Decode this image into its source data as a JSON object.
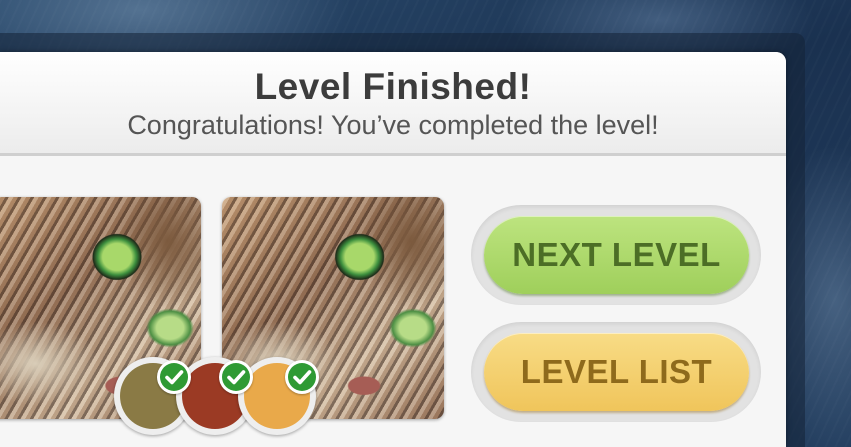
{
  "dialog": {
    "title": "Level Finished!",
    "subtitle": "Congratulations! You’ve completed the level!"
  },
  "buttons": {
    "next_level": "NEXT LEVEL",
    "level_list": "LEVEL LIST"
  },
  "color_swatches": [
    {
      "color": "#8a7a45",
      "completed": true
    },
    {
      "color": "#9b3a24",
      "completed": true
    },
    {
      "color": "#e9a94a",
      "completed": true
    }
  ],
  "colors": {
    "next_button": "#a8d765",
    "list_button": "#f3cc68",
    "check_badge": "#2f9a34"
  }
}
